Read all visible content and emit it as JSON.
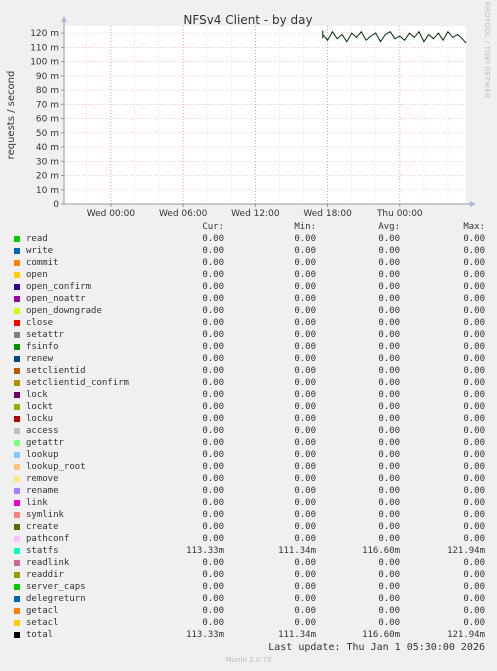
{
  "chart_data": {
    "type": "line",
    "title": "NFSv4 Client - by day",
    "ylabel": "requests / second",
    "ylim": [
      0,
      125
    ],
    "y_unit": "m",
    "y_ticks": [
      0,
      10,
      20,
      30,
      40,
      50,
      60,
      70,
      80,
      90,
      100,
      110,
      120
    ],
    "y_tick_labels": [
      "0",
      "10 m",
      "20 m",
      "30 m",
      "40 m",
      "50 m",
      "60 m",
      "70 m",
      "80 m",
      "90 m",
      "100 m",
      "110 m",
      "120 m"
    ],
    "x_tick_labels": [
      "Wed 00:00",
      "Wed 06:00",
      "Wed 12:00",
      "Wed 18:00",
      "Thu 00:00"
    ],
    "x_tick_hours": [
      0,
      6,
      12,
      18,
      24
    ],
    "x_range_hours": [
      -3.9,
      29.5
    ],
    "grid": true,
    "series": [
      {
        "name": "statfs",
        "color": "#00290e",
        "x_hours": [
          17.6,
          18.0,
          18.4,
          18.8,
          19.2,
          19.6,
          20.0,
          20.4,
          20.8,
          21.2,
          21.6,
          22.0,
          22.4,
          22.8,
          23.2,
          23.6,
          24.0,
          24.4,
          24.8,
          25.2,
          25.6,
          26.0,
          26.4,
          26.8,
          27.2,
          27.6,
          28.0,
          28.4,
          28.8,
          29.2,
          29.5
        ],
        "values": [
          119,
          115,
          121,
          116,
          119,
          114,
          120,
          117,
          121,
          115,
          118,
          120,
          114,
          119,
          121,
          116,
          118,
          115,
          120,
          117,
          121,
          114,
          119,
          116,
          120,
          115,
          121,
          117,
          119,
          116,
          113
        ]
      }
    ]
  },
  "rrdtool_label": "RRDTOOL / TOBI OETIKER",
  "legend": {
    "headers": {
      "cur": "Cur:",
      "min": "Min:",
      "avg": "Avg:",
      "max": "Max:"
    },
    "rows": [
      {
        "name": "read",
        "color": "#00cc00",
        "cur": "0.00",
        "min": "0.00",
        "avg": "0.00",
        "max": "0.00"
      },
      {
        "name": "write",
        "color": "#0066b3",
        "cur": "0.00",
        "min": "0.00",
        "avg": "0.00",
        "max": "0.00"
      },
      {
        "name": "commit",
        "color": "#ff8000",
        "cur": "0.00",
        "min": "0.00",
        "avg": "0.00",
        "max": "0.00"
      },
      {
        "name": "open",
        "color": "#ffcc00",
        "cur": "0.00",
        "min": "0.00",
        "avg": "0.00",
        "max": "0.00"
      },
      {
        "name": "open_confirm",
        "color": "#330099",
        "cur": "0.00",
        "min": "0.00",
        "avg": "0.00",
        "max": "0.00"
      },
      {
        "name": "open_noattr",
        "color": "#990099",
        "cur": "0.00",
        "min": "0.00",
        "avg": "0.00",
        "max": "0.00"
      },
      {
        "name": "open_downgrade",
        "color": "#ccff00",
        "cur": "0.00",
        "min": "0.00",
        "avg": "0.00",
        "max": "0.00"
      },
      {
        "name": "close",
        "color": "#ff0000",
        "cur": "0.00",
        "min": "0.00",
        "avg": "0.00",
        "max": "0.00"
      },
      {
        "name": "setattr",
        "color": "#808080",
        "cur": "0.00",
        "min": "0.00",
        "avg": "0.00",
        "max": "0.00"
      },
      {
        "name": "fsinfo",
        "color": "#008f00",
        "cur": "0.00",
        "min": "0.00",
        "avg": "0.00",
        "max": "0.00"
      },
      {
        "name": "renew",
        "color": "#00487d",
        "cur": "0.00",
        "min": "0.00",
        "avg": "0.00",
        "max": "0.00"
      },
      {
        "name": "setclientid",
        "color": "#b35a00",
        "cur": "0.00",
        "min": "0.00",
        "avg": "0.00",
        "max": "0.00"
      },
      {
        "name": "setclientid_confirm",
        "color": "#b38f00",
        "cur": "0.00",
        "min": "0.00",
        "avg": "0.00",
        "max": "0.00"
      },
      {
        "name": "lock",
        "color": "#6b006b",
        "cur": "0.00",
        "min": "0.00",
        "avg": "0.00",
        "max": "0.00"
      },
      {
        "name": "lockt",
        "color": "#8fb300",
        "cur": "0.00",
        "min": "0.00",
        "avg": "0.00",
        "max": "0.00"
      },
      {
        "name": "locku",
        "color": "#b30000",
        "cur": "0.00",
        "min": "0.00",
        "avg": "0.00",
        "max": "0.00"
      },
      {
        "name": "access",
        "color": "#bebebe",
        "cur": "0.00",
        "min": "0.00",
        "avg": "0.00",
        "max": "0.00"
      },
      {
        "name": "getattr",
        "color": "#80ff80",
        "cur": "0.00",
        "min": "0.00",
        "avg": "0.00",
        "max": "0.00"
      },
      {
        "name": "lookup",
        "color": "#80c9ff",
        "cur": "0.00",
        "min": "0.00",
        "avg": "0.00",
        "max": "0.00"
      },
      {
        "name": "lookup_root",
        "color": "#ffc080",
        "cur": "0.00",
        "min": "0.00",
        "avg": "0.00",
        "max": "0.00"
      },
      {
        "name": "remove",
        "color": "#ffe680",
        "cur": "0.00",
        "min": "0.00",
        "avg": "0.00",
        "max": "0.00"
      },
      {
        "name": "rename",
        "color": "#aa80ff",
        "cur": "0.00",
        "min": "0.00",
        "avg": "0.00",
        "max": "0.00"
      },
      {
        "name": "link",
        "color": "#ee00cc",
        "cur": "0.00",
        "min": "0.00",
        "avg": "0.00",
        "max": "0.00"
      },
      {
        "name": "symlink",
        "color": "#ff8080",
        "cur": "0.00",
        "min": "0.00",
        "avg": "0.00",
        "max": "0.00"
      },
      {
        "name": "create",
        "color": "#666600",
        "cur": "0.00",
        "min": "0.00",
        "avg": "0.00",
        "max": "0.00"
      },
      {
        "name": "pathconf",
        "color": "#ffbfff",
        "cur": "0.00",
        "min": "0.00",
        "avg": "0.00",
        "max": "0.00"
      },
      {
        "name": "statfs",
        "color": "#00ffcc",
        "cur": "113.33m",
        "min": "111.34m",
        "avg": "116.60m",
        "max": "121.94m"
      },
      {
        "name": "readlink",
        "color": "#cc6699",
        "cur": "0.00",
        "min": "0.00",
        "avg": "0.00",
        "max": "0.00"
      },
      {
        "name": "readdir",
        "color": "#999900",
        "cur": "0.00",
        "min": "0.00",
        "avg": "0.00",
        "max": "0.00"
      },
      {
        "name": "server_caps",
        "color": "#00cc00",
        "cur": "0.00",
        "min": "0.00",
        "avg": "0.00",
        "max": "0.00"
      },
      {
        "name": "delegreturn",
        "color": "#0066b3",
        "cur": "0.00",
        "min": "0.00",
        "avg": "0.00",
        "max": "0.00"
      },
      {
        "name": "getacl",
        "color": "#ff8000",
        "cur": "0.00",
        "min": "0.00",
        "avg": "0.00",
        "max": "0.00"
      },
      {
        "name": "setacl",
        "color": "#ffcc00",
        "cur": "0.00",
        "min": "0.00",
        "avg": "0.00",
        "max": "0.00"
      },
      {
        "name": "total",
        "color": "#000000",
        "cur": "113.33m",
        "min": "111.34m",
        "avg": "116.60m",
        "max": "121.94m"
      }
    ]
  },
  "footer": {
    "last_update": "Last update: Thu Jan  1 05:30:00 2026",
    "munin_version": "Munin 2.0.73"
  }
}
